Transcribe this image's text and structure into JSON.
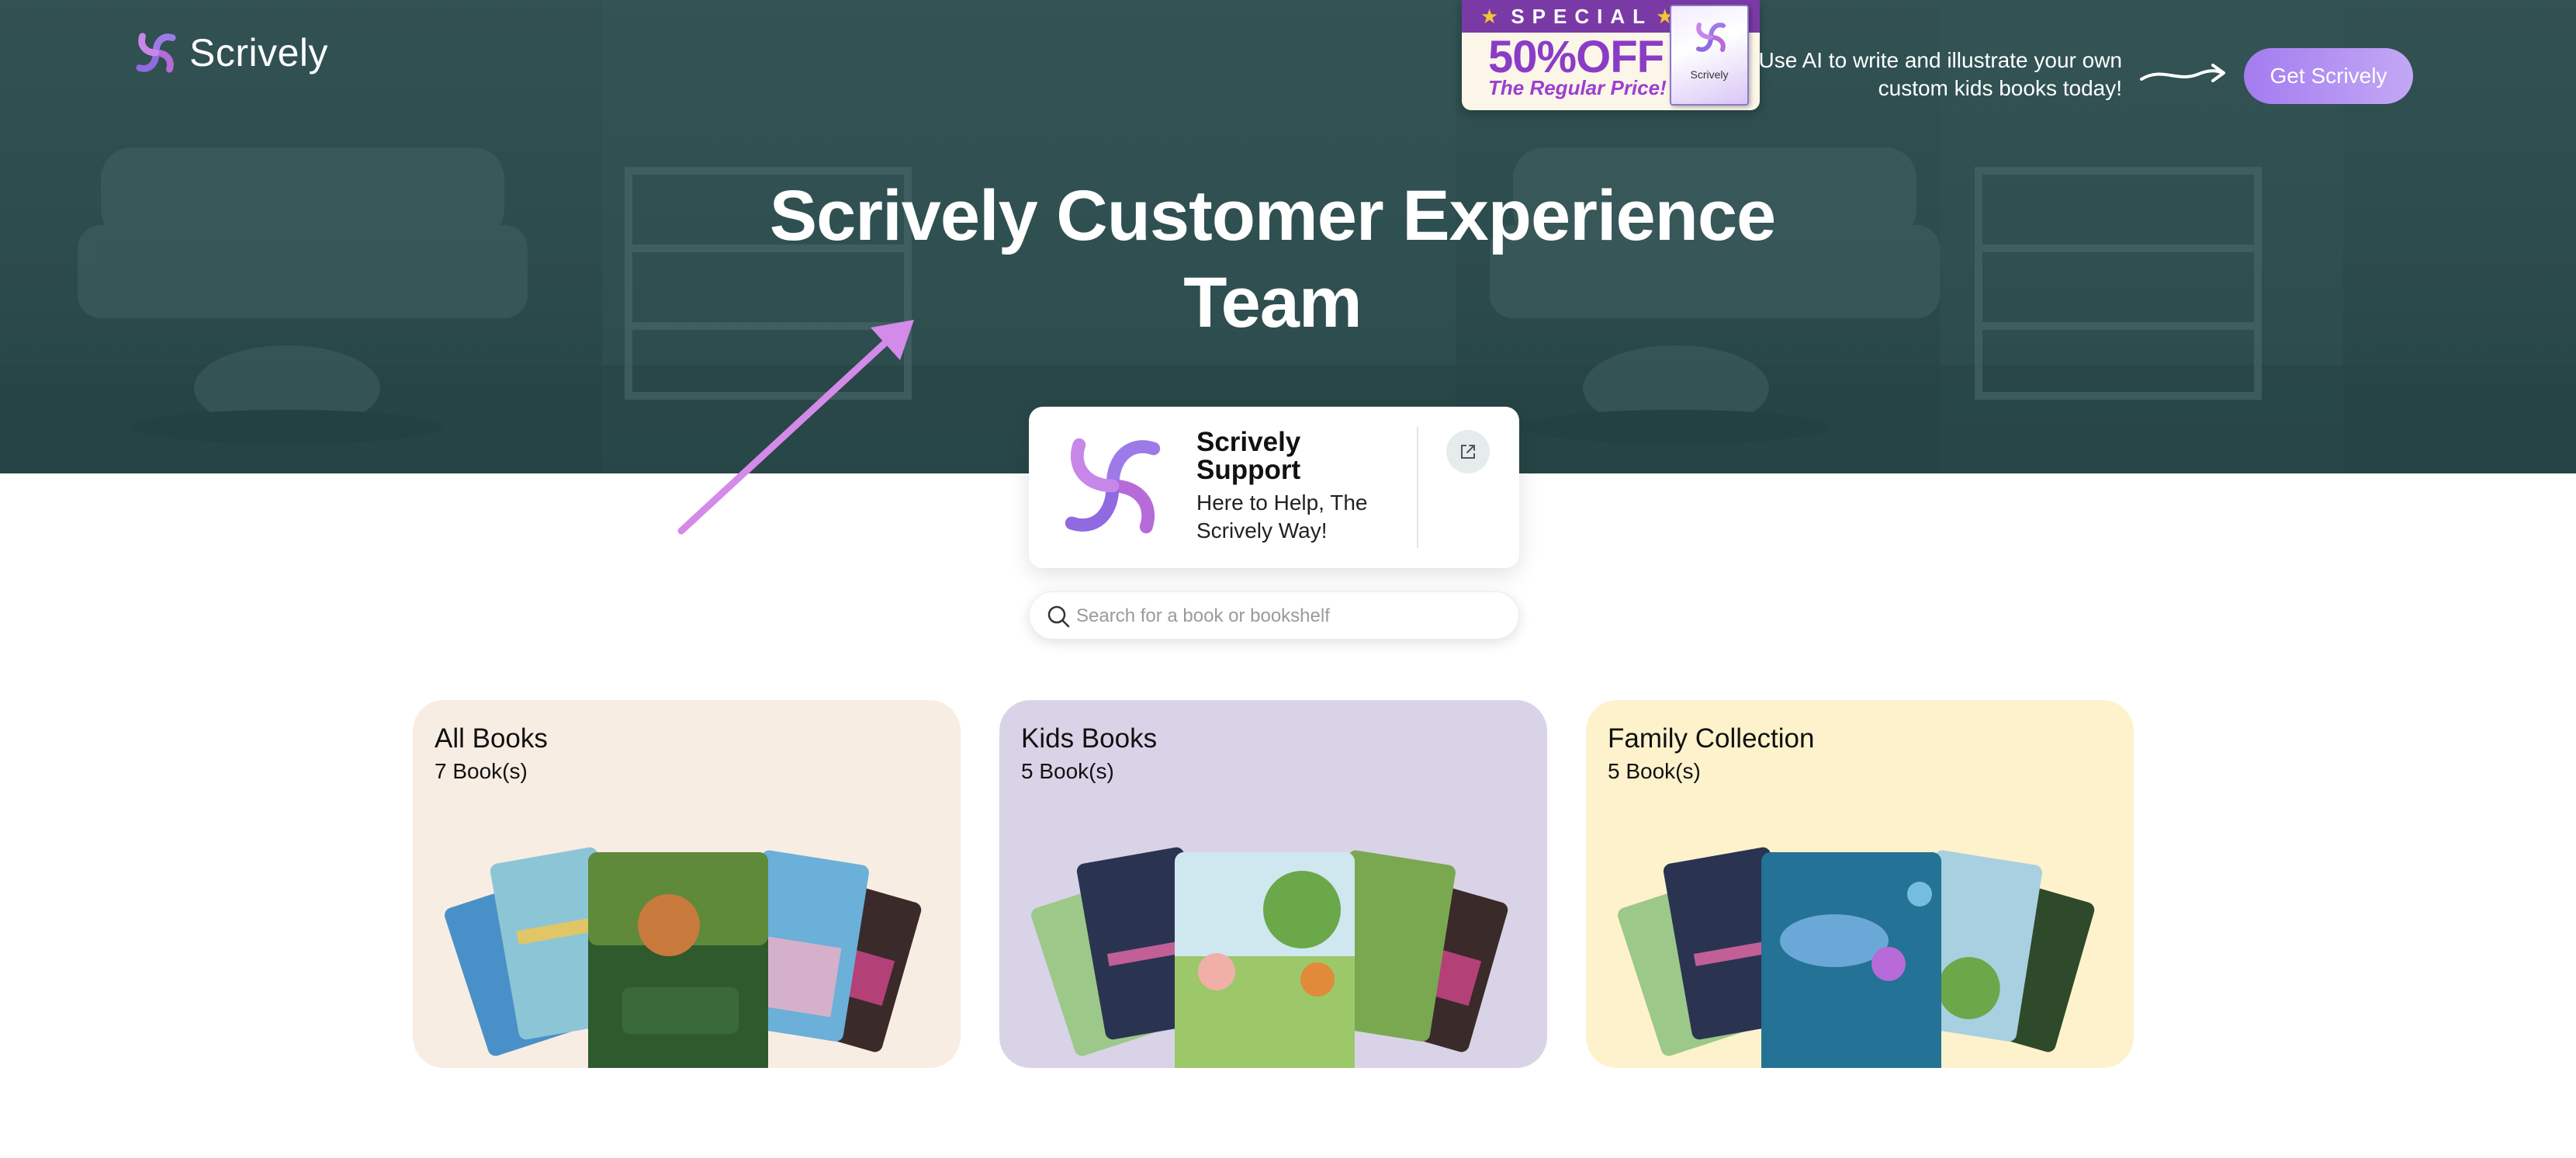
{
  "header": {
    "logo_text": "Scrively",
    "promo": {
      "banner": "SPECIAL",
      "headline": "50%OFF",
      "subline": "The Regular Price!",
      "book_title": "Scrively"
    },
    "cta_text": "Use AI to write and illustrate your own custom kids books today!",
    "cta_button": "Get Scrively"
  },
  "hero": {
    "title_line1": "Scrively Customer Experience",
    "title_line2": "Team"
  },
  "profile": {
    "name": "Scrively Support",
    "tagline": "Here to Help, The Scrively Way!",
    "link_icon": "external-link-icon"
  },
  "search": {
    "placeholder": "Search for a book or bookshelf",
    "value": ""
  },
  "bookshelves": [
    {
      "title": "All Books",
      "count": "7 Book(s)",
      "bg": "#f8ede3"
    },
    {
      "title": "Kids Books",
      "count": "5 Book(s)",
      "bg": "#d9d3e8"
    },
    {
      "title": "Family Collection",
      "count": "5 Book(s)",
      "bg": "#fdf2cc"
    }
  ],
  "colors": {
    "accent": "#a37cf0",
    "hero_bg": "#3c5e5f",
    "promo_purple": "#8b3cc7"
  }
}
